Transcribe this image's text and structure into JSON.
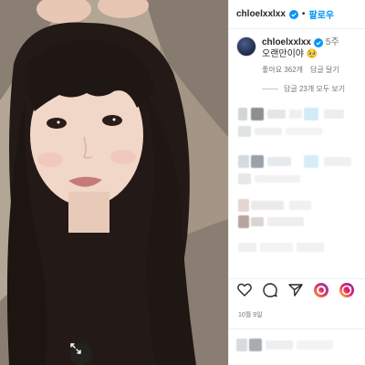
{
  "header": {
    "username": "chloelxxlxx",
    "separator": "•",
    "follow_label": "팔로우"
  },
  "caption": {
    "username": "chloelxxlxx",
    "time": "5주",
    "text": "오랜만이야 🥺",
    "likes": "좋아요 362개",
    "reply_label": "답글 달기"
  },
  "replies": {
    "label": "답글 23개 모두 보기"
  },
  "date": "10월 9일",
  "icons": {
    "verified": "verified-badge-icon",
    "like": "heart-icon",
    "comment": "comment-icon",
    "share": "send-icon",
    "expand": "expand-arrows-icon"
  },
  "colors": {
    "accent": "#0095f6",
    "verified": "#0095f6",
    "muted_text": "#737373",
    "text": "#262626",
    "divider": "#efefef"
  }
}
